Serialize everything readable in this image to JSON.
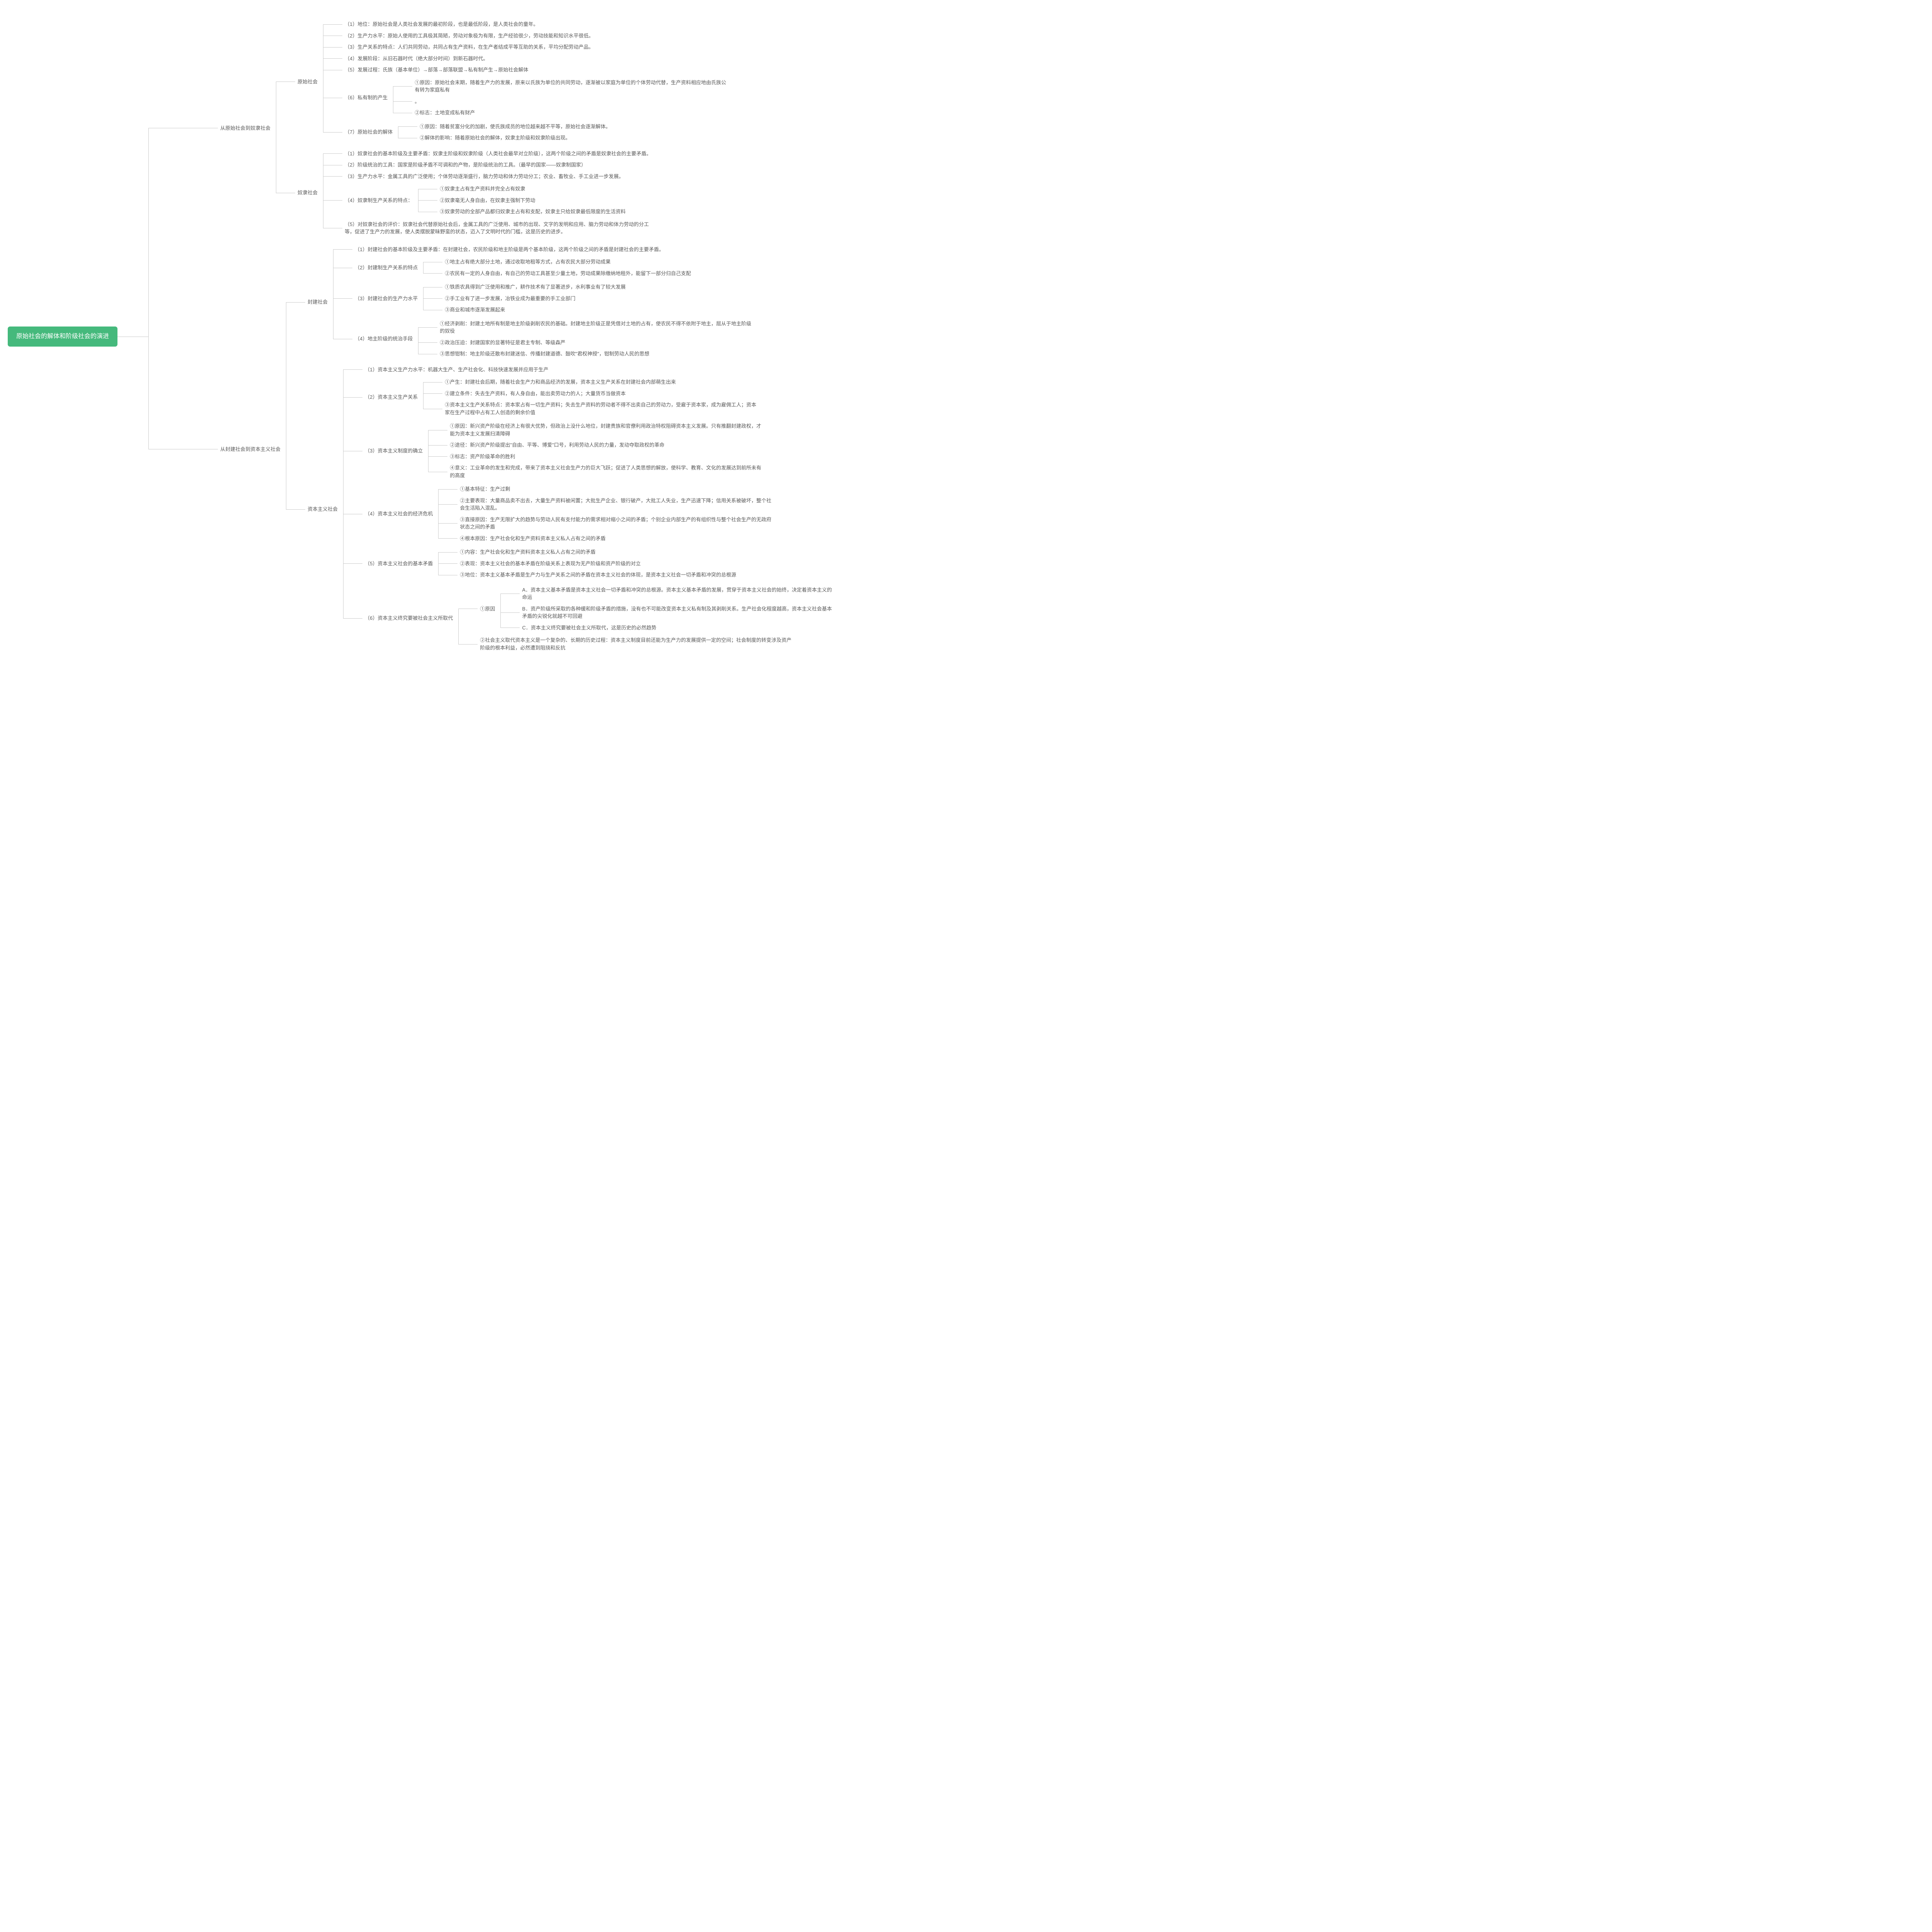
{
  "root": "原始社会的解体和阶级社会的演进",
  "l1": {
    "a": "从原始社会到奴隶社会",
    "b": "从封建社会到资本主义社会"
  },
  "prim": {
    "title": "原始社会",
    "i1": "（1）地位：原始社会是人类社会发展的最初阶段，也是最低阶段，是人类社会的童年。",
    "i2": "（2）生产力水平：原始人使用的工具极其简陋，劳动对象极为有限，生产经验很少，劳动技能和知识水平很低。",
    "i3": "（3）生产关系的特点：人们共同劳动，共同占有生产资料，在生产者结成平等互助的关系，平均分配劳动产品。",
    "i4": "（4）发展阶段：从旧石器时代（绝大部分时间）到新石器时代。",
    "i5": "（5）发展过程：氏族（基本单位）→部落→部落联盟→私有制产生→原始社会解体",
    "i6": "（6）私有制的产生",
    "i6a": "①原因：原始社会末期，随着生产力的发展，原来以氏族为单位的共同劳动，逐渐被以家庭为单位的个体劳动代替，生产资料相应地由氏族公有转为家庭私有",
    "i6b": "。",
    "i6c": "②标志：土地变成私有财产",
    "i7": "（7）原始社会的解体",
    "i7a": "①原因：随着贫富分化的加剧，使氏族成员的地位越来越不平等，原始社会逐渐解体。",
    "i7b": "②解体的影响：随着原始社会的解体，奴隶主阶级和奴隶阶级出现。"
  },
  "slave": {
    "title": "奴隶社会",
    "i1": "（1）奴隶社会的基本阶级及主要矛盾：奴隶主阶级和奴隶阶级（人类社会最早对立阶级），这两个阶级之间的矛盾是奴隶社会的主要矛盾。",
    "i2": "（2）阶级统治的工具：国家是阶级矛盾不可调和的产物，是阶级统治的工具。（最早的国家——奴隶制国家）",
    "i3": "（3）生产力水平：金属工具的广泛使用；个体劳动逐渐盛行，脑力劳动和体力劳动分工；农业、畜牧业、手工业进一步发展。",
    "i4": "（4）奴隶制生产关系的特点：",
    "i4a": "①奴隶主占有生产资料并完全占有奴隶",
    "i4b": "②奴隶毫无人身自由，在奴隶主强制下劳动",
    "i4c": "③奴隶劳动的全部产品都归奴隶主占有和支配，奴隶主只给奴隶最低限度的生活资料",
    "i5": "（5）对奴隶社会的评价：奴隶社会代替原始社会后，金属工具的广泛使用、城市的出现、文字的发明和应用、脑力劳动和体力劳动的分工等，促进了生产力的发展，使人类摆脱蒙昧野蛮的状态，迈入了文明时代的门槛，这是历史的进步。"
  },
  "feud": {
    "title": "封建社会",
    "i1": "（1）封建社会的基本阶级及主要矛盾：在封建社会，农民阶级和地主阶级是两个基本阶级，这两个阶级之间的矛盾是封建社会的主要矛盾。",
    "i2": "（2）封建制生产关系的特点",
    "i2a": "①地主占有绝大部分土地，通过收取地租等方式，占有农民大部分劳动成果",
    "i2b": "②农民有一定的人身自由，有自己的劳动工具甚至少量土地，劳动成果除缴纳地租外，能留下一部分归自己支配",
    "i3": "（3）封建社会的生产力水平",
    "i3a": "①铁质农具得到广泛使用和推广，耕作技术有了显著进步，水利事业有了较大发展",
    "i3b": "②手工业有了进一步发展，冶铁业成为最重要的手工业部门",
    "i3c": "③商业和城市逐渐发展起来",
    "i4": "（4）地主阶级的统治手段",
    "i4a": "①经济剥削：封建土地所有制是地主阶级剥削农民的基础。封建地主阶级正是凭借对土地的占有，使农民不得不依附于地主，屈从于地主阶级的奴役",
    "i4b": "②政治压迫：封建国家的显著特征是君主专制、等级森严",
    "i4c": "③思想钳制：地主阶级还散布封建迷信、传播封建道德、鼓吹\"君权神授\"，钳制劳动人民的思想"
  },
  "cap": {
    "title": "资本主义社会",
    "i1": "（1）资本主义生产力水平：机器大生产、生产社会化、科技快速发展并应用于生产",
    "i2": "（2）资本主义生产关系",
    "i2a": "①产生：封建社会后期，随着社会生产力和商品经济的发展，资本主义生产关系在封建社会内部萌生出来",
    "i2b": "②建立条件：失去生产资料，有人身自由，能出卖劳动力的人；大量货币当做资本",
    "i2c": "③资本主义生产关系特点：资本家占有一切生产资料；失去生产资料的劳动者不得不出卖自己的劳动力，受雇于资本家，成为雇佣工人；资本家在生产过程中占有工人创造的剩余价值",
    "i3": "（3）资本主义制度的确立",
    "i3a": "①原因：新兴资产阶级在经济上有很大优势，但政治上没什么地位，封建贵族和官僚利用政治特权阻碍资本主义发展。只有推翻封建政权，才能为资本主义发展扫清障碍",
    "i3b": "②途径：新兴资产阶级提出\"自由、平等、博爱\"口号，利用劳动人民的力量，发动夺取政权的革命",
    "i3c": "③标志：资产阶级革命的胜利",
    "i3d": "④意义：工业革命的发生和完成，带来了资本主义社会生产力的巨大飞跃；促进了人类思想的解放，使科学、教育、文化的发展达到前所未有的高度",
    "i4": "（4）资本主义社会的经济危机",
    "i4a": "①基本特征：生产过剩",
    "i4b": "②主要表现：大量商品卖不出去，大量生产资料被闲置；大批生产企业、银行破产，大批工人失业，生产迅速下降；信用关系被破坏，整个社会生活陷入混乱。",
    "i4c": "③直接原因：生产无限扩大的趋势与劳动人民有支付能力的需求相对缩小之间的矛盾；个别企业内部生产的有组织性与整个社会生产的无政府状态之间的矛盾",
    "i4d": "④根本原因：生产社会化和生产资料资本主义私人占有之间的矛盾",
    "i5": "（5）资本主义社会的基本矛盾",
    "i5a": "①内容：生产社会化和生产资料资本主义私人占有之间的矛盾",
    "i5b": "②表现：资本主义社会的基本矛盾在阶级关系上表现为无产阶级和资产阶级的对立",
    "i5c": "③地位：资本主义基本矛盾是生产力与生产关系之间的矛盾在资本主义社会的体现，是资本主义社会一切矛盾和冲突的总根源",
    "i6": "（6）资本主义终究要被社会主义所取代",
    "i6a": "①原因",
    "i6aa": "A．资本主义基本矛盾是资本主义社会一切矛盾和冲突的总根源。资本主义基本矛盾的发展，贯穿于资本主义社会的始终，决定着资本主义的命运",
    "i6ab": "B．资产阶级所采取的各种缓和阶级矛盾的措施，没有也不可能改变资本主义私有制及其剥削关系。生产社会化程度越高，资本主义社会基本矛盾的尖锐化就越不可回避",
    "i6ac": "C．资本主义终究要被社会主义所取代，这是历史的必然趋势",
    "i6b": "②社会主义取代资本主义是一个复杂的、长期的历史过程：资本主义制度目前还能为生产力的发展提供一定的空间；社会制度的转变涉及资产阶级的根本利益，必然遭到阻挠和反抗"
  }
}
